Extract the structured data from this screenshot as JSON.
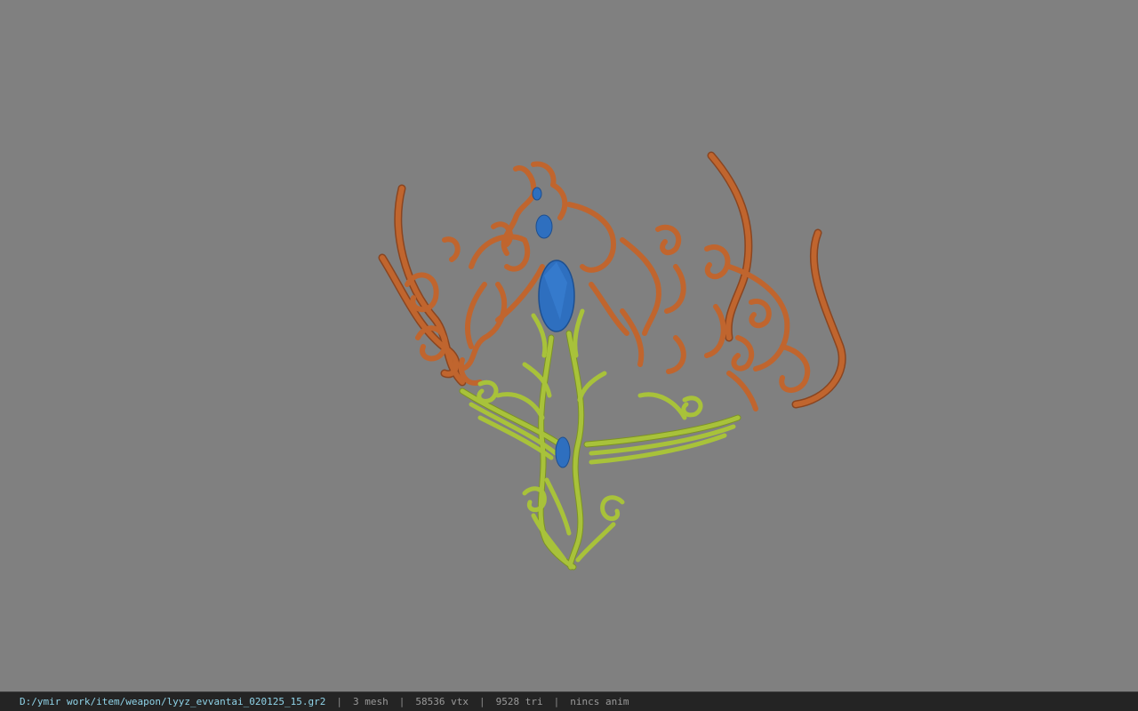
{
  "viewer": {
    "background_color": "#808080",
    "model_colors": {
      "frame": "#c0652e",
      "frame_shade": "#8a4520",
      "vine": "#a8c23a",
      "vine_shade": "#7c9226",
      "gem": "#2e6fbf",
      "gem_shade": "#1d4f90"
    }
  },
  "status": {
    "file_path": "D:/ymir work/item/weapon/lyyz_evvantai_020125_15.gr2",
    "separator": "|",
    "mesh_count": "3 mesh",
    "vertex_count": "58536 vtx",
    "triangle_count": "9528 tri",
    "animation": "nincs anim",
    "path_color": "#8fd3e8",
    "bar_color": "#242424"
  }
}
